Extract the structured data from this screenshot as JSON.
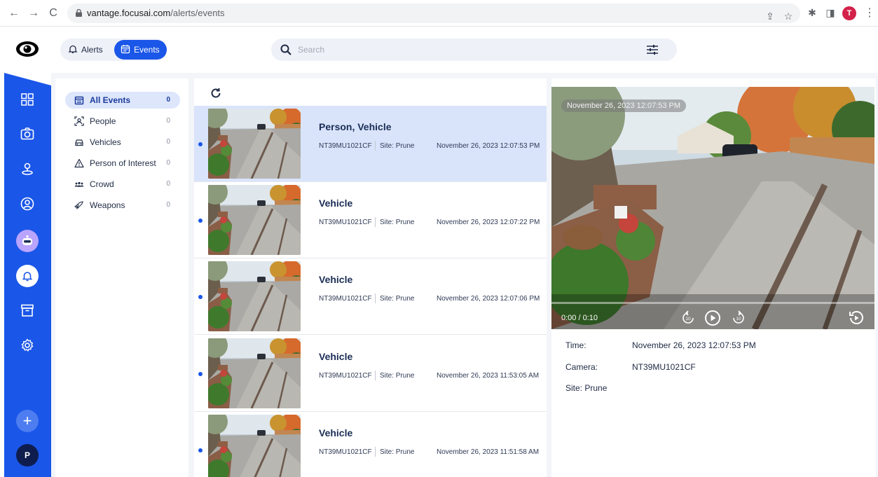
{
  "browser": {
    "url_host": "vantage.focusai.com",
    "url_path": "/alerts/events",
    "profile_initial": "T"
  },
  "topbar": {
    "alerts_label": "Alerts",
    "events_label": "Events",
    "search_placeholder": "Search"
  },
  "rail": {
    "avatar_initial": "P",
    "icons": [
      "dashboard-icon",
      "camera-icon",
      "map-pin-icon",
      "face-scan-icon",
      "bot-icon",
      "bell-icon",
      "archive-icon",
      "settings-icon",
      "add-icon"
    ]
  },
  "categories": [
    {
      "label": "All Events",
      "count": "0",
      "icon": "calendar-icon"
    },
    {
      "label": "People",
      "count": "0",
      "icon": "person-scan-icon"
    },
    {
      "label": "Vehicles",
      "count": "0",
      "icon": "car-icon"
    },
    {
      "label": "Person of Interest",
      "count": "0",
      "icon": "warning-icon"
    },
    {
      "label": "Crowd",
      "count": "0",
      "icon": "group-icon"
    },
    {
      "label": "Weapons",
      "count": "0",
      "icon": "weapon-icon"
    }
  ],
  "events": [
    {
      "title": "Person, Vehicle",
      "camera": "NT39MU1021CF",
      "site": "Site: Prune",
      "time": "November 26, 2023 12:07:53 PM"
    },
    {
      "title": "Vehicle",
      "camera": "NT39MU1021CF",
      "site": "Site: Prune",
      "time": "November 26, 2023 12:07:22 PM"
    },
    {
      "title": "Vehicle",
      "camera": "NT39MU1021CF",
      "site": "Site: Prune",
      "time": "November 26, 2023 12:07:06 PM"
    },
    {
      "title": "Vehicle",
      "camera": "NT39MU1021CF",
      "site": "Site: Prune",
      "time": "November 26, 2023 11:53:05 AM"
    },
    {
      "title": "Vehicle",
      "camera": "NT39MU1021CF",
      "site": "Site: Prune",
      "time": "November 26, 2023 11:51:58 AM"
    }
  ],
  "detail": {
    "video_timestamp": "November 26, 2023 12:07:53 PM",
    "video_time": "0:00 / 0:10",
    "time_label": "Time:",
    "time_value": "November 26, 2023 12:07:53 PM",
    "camera_label": "Camera:",
    "camera_value": "NT39MU1021CF",
    "site_label": "Site: Prune"
  },
  "colors": {
    "accent": "#1a56e8",
    "selected_row": "#d9e4fb",
    "rail": "#1a56e8"
  }
}
